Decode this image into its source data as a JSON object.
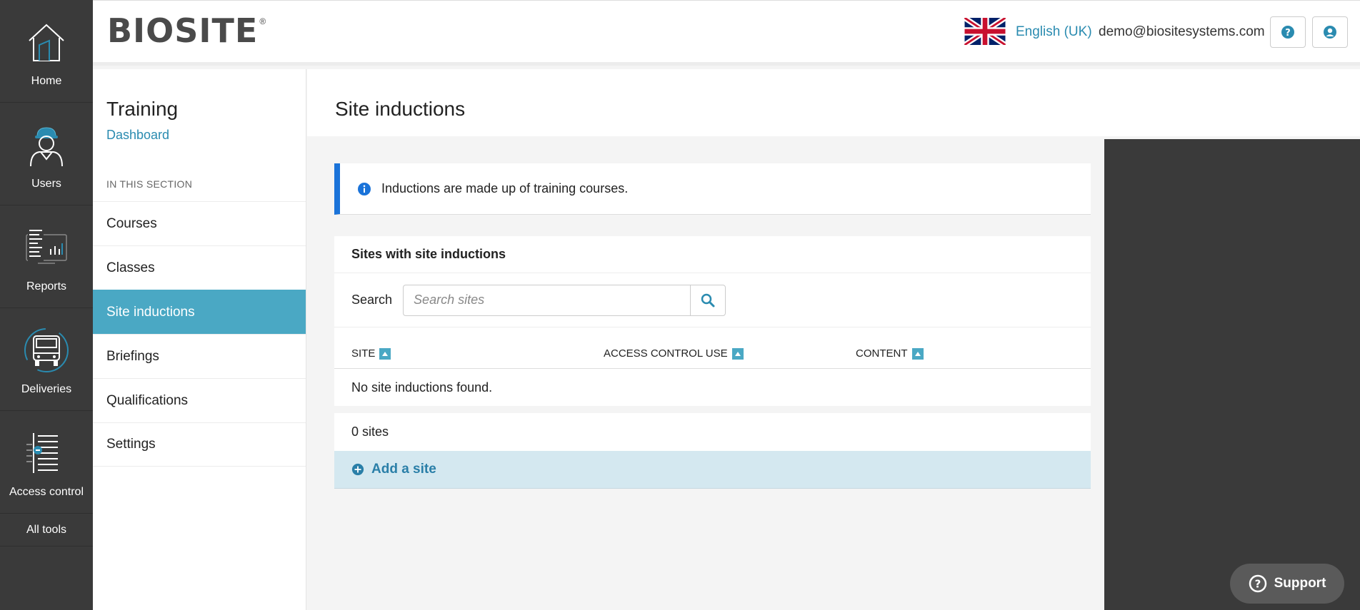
{
  "rail": {
    "items": [
      {
        "label": "Home",
        "icon": "home-icon"
      },
      {
        "label": "Users",
        "icon": "worker-icon"
      },
      {
        "label": "Reports",
        "icon": "reports-icon"
      },
      {
        "label": "Deliveries",
        "icon": "truck-icon"
      },
      {
        "label": "Access control",
        "icon": "access-control-icon"
      }
    ],
    "all_tools": "All tools"
  },
  "header": {
    "logo": "BIOSITE",
    "logo_mark": "®",
    "language": "English (UK)",
    "email": "demo@biositesystems.com"
  },
  "sidebar": {
    "title": "Training",
    "dashboard_link": "Dashboard",
    "section_label": "IN THIS SECTION",
    "items": [
      {
        "label": "Courses",
        "active": false
      },
      {
        "label": "Classes",
        "active": false
      },
      {
        "label": "Site inductions",
        "active": true
      },
      {
        "label": "Briefings",
        "active": false
      },
      {
        "label": "Qualifications",
        "active": false
      },
      {
        "label": "Settings",
        "active": false
      }
    ]
  },
  "main": {
    "title": "Site inductions",
    "info_text": "Inductions are made up of training courses.",
    "card": {
      "title": "Sites with site inductions",
      "search_label": "Search",
      "search_placeholder": "Search sites",
      "columns": [
        "SITE",
        "ACCESS CONTROL USE",
        "CONTENT"
      ],
      "empty_text": "No site inductions found."
    },
    "count": "0 sites",
    "add_label": "Add a site"
  },
  "support": {
    "label": "Support"
  },
  "colors": {
    "accent": "#4aa8c4",
    "link": "#2a8bb0",
    "info_border": "#1a73d9",
    "rail": "#3a3a3a"
  }
}
